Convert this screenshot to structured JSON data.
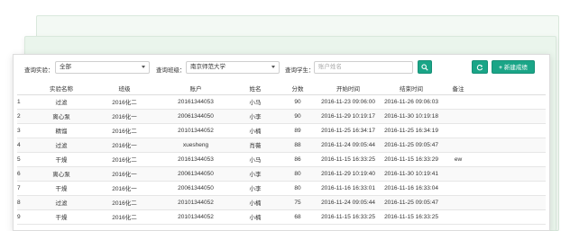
{
  "filters": {
    "experiment_label": "查询实验：",
    "experiment_value": "全部",
    "class_label": "查询班级：",
    "class_value": "南京师范大学",
    "student_label": "查询学生：",
    "student_placeholder": "账户姓名"
  },
  "buttons": {
    "search_icon": "search-icon",
    "refresh_icon": "refresh-icon",
    "add_label": "新建成绩"
  },
  "colors": {
    "accent": "#1aa587",
    "background_card": "#eaf5ec"
  },
  "table": {
    "headers": [
      "",
      "实验名称",
      "班级",
      "账户",
      "姓名",
      "分数",
      "开始时间",
      "结束时间",
      "备注"
    ],
    "rows": [
      [
        "1",
        "过滤",
        "2016化二",
        "20161344053",
        "小马",
        "90",
        "2016-11-23 09:06:00",
        "2016-11-26 09:06:03",
        ""
      ],
      [
        "2",
        "离心泵",
        "2016化一",
        "20061344050",
        "小李",
        "90",
        "2016-11-29 10:19:17",
        "2016-11-30 10:19:18",
        ""
      ],
      [
        "3",
        "精馏",
        "2016化二",
        "20101344052",
        "小楠",
        "89",
        "2016-11-25 16:34:17",
        "2016-11-25 16:34:19",
        ""
      ],
      [
        "4",
        "过滤",
        "2016化一",
        "xuesheng",
        "肖薇",
        "88",
        "2016-11-24 09:05:44",
        "2016-11-25 09:05:47",
        ""
      ],
      [
        "5",
        "干燥",
        "2016化二",
        "20161344053",
        "小马",
        "86",
        "2016-11-15 16:33:25",
        "2016-11-15 16:33:29",
        "ew"
      ],
      [
        "6",
        "离心泵",
        "2016化一",
        "20061344050",
        "小李",
        "80",
        "2016-11-29 10:19:40",
        "2016-11-30 10:19:41",
        ""
      ],
      [
        "7",
        "干燥",
        "2016化一",
        "20061344050",
        "小李",
        "80",
        "2016-11-16 16:33:01",
        "2016-11-16 16:33:04",
        ""
      ],
      [
        "8",
        "过滤",
        "2016化二",
        "20101344052",
        "小楠",
        "75",
        "2016-11-24 09:05:44",
        "2016-11-25 09:05:47",
        ""
      ],
      [
        "9",
        "干燥",
        "2016化二",
        "20101344052",
        "小楠",
        "68",
        "2016-11-15 16:33:25",
        "2016-11-15 16:33:25",
        ""
      ]
    ]
  }
}
